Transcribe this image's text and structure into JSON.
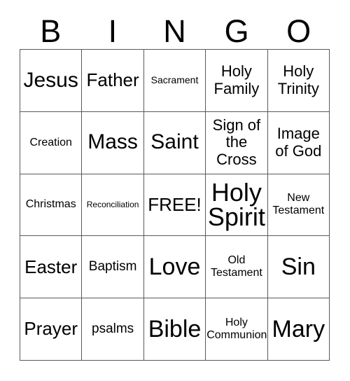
{
  "card": {
    "title": "BINGO",
    "background_color": "#ffffff",
    "text_color": "#000000",
    "grid_line_color": "#595959"
  },
  "header": {
    "letters": [
      "B",
      "I",
      "N",
      "G",
      "O"
    ]
  },
  "grid": {
    "rows": 5,
    "columns": 5,
    "free_space_label": "FREE!",
    "free_space_position": {
      "row": 3,
      "column": 3
    },
    "cells": [
      [
        {
          "label": "Jesus",
          "size": "fs-xl"
        },
        {
          "label": "Father",
          "size": "fs-l"
        },
        {
          "label": "Sacrament",
          "size": "fs-xs"
        },
        {
          "label": "Holy Family",
          "size": "fs-ml"
        },
        {
          "label": "Holy Trinity",
          "size": "fs-ml"
        }
      ],
      [
        {
          "label": "Creation",
          "size": "fs-s"
        },
        {
          "label": "Mass",
          "size": "fs-xl"
        },
        {
          "label": "Saint",
          "size": "fs-xl"
        },
        {
          "label": "Sign of the Cross",
          "size": "fs-ml"
        },
        {
          "label": "Image of God",
          "size": "fs-ml"
        }
      ],
      [
        {
          "label": "Christmas",
          "size": "fs-s"
        },
        {
          "label": "Reconciliation",
          "size": "fs-xxs"
        },
        {
          "label": "FREE!",
          "size": "fs-l"
        },
        {
          "label": "Holy Spirit",
          "size": "fs-3xl"
        },
        {
          "label": "New Testament",
          "size": "fs-s"
        }
      ],
      [
        {
          "label": "Easter",
          "size": "fs-l"
        },
        {
          "label": "Baptism",
          "size": "fs-m"
        },
        {
          "label": "Love",
          "size": "fs-xxl"
        },
        {
          "label": "Old Testament",
          "size": "fs-s"
        },
        {
          "label": "Sin",
          "size": "fs-xxl"
        }
      ],
      [
        {
          "label": "Prayer",
          "size": "fs-l"
        },
        {
          "label": "psalms",
          "size": "fs-m"
        },
        {
          "label": "Bible",
          "size": "fs-xxl"
        },
        {
          "label": "Holy Communion",
          "size": "fs-s"
        },
        {
          "label": "Mary",
          "size": "fs-xxl"
        }
      ]
    ]
  }
}
